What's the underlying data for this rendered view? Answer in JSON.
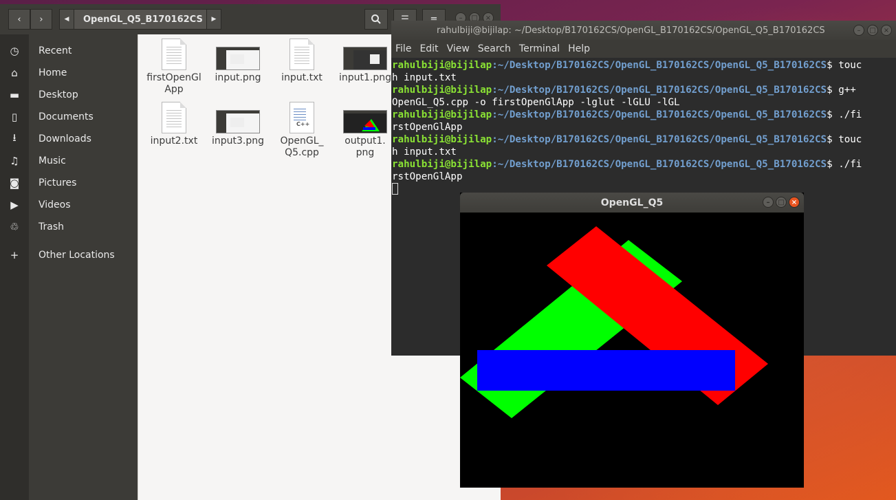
{
  "files": {
    "current_folder": "OpenGL_Q5_B170162CS",
    "places": [
      {
        "icon": "clock-icon",
        "glyph": "◷",
        "label": "Recent"
      },
      {
        "icon": "home-icon",
        "glyph": "⌂",
        "label": "Home"
      },
      {
        "icon": "folder-icon",
        "glyph": "▬",
        "label": "Desktop"
      },
      {
        "icon": "document-icon",
        "glyph": "▯",
        "label": "Documents"
      },
      {
        "icon": "download-icon",
        "glyph": "⭳",
        "label": "Downloads"
      },
      {
        "icon": "music-icon",
        "glyph": "♫",
        "label": "Music"
      },
      {
        "icon": "camera-icon",
        "glyph": "◙",
        "label": "Pictures"
      },
      {
        "icon": "video-icon",
        "glyph": "▶",
        "label": "Videos"
      },
      {
        "icon": "trash-icon",
        "glyph": "♲",
        "label": "Trash"
      },
      {
        "icon": "plus-icon",
        "glyph": "+",
        "label": "Other Locations"
      }
    ],
    "items": [
      {
        "name_line1": "firstOpenGl",
        "name_line2": "App",
        "kind": "doc"
      },
      {
        "name_line1": "input.png",
        "name_line2": "",
        "kind": "image"
      },
      {
        "name_line1": "input.txt",
        "name_line2": "",
        "kind": "doc"
      },
      {
        "name_line1": "input1.png",
        "name_line2": "",
        "kind": "image"
      },
      {
        "name_line1": "input2.txt",
        "name_line2": "",
        "kind": "doc"
      },
      {
        "name_line1": "input3.png",
        "name_line2": "",
        "kind": "image"
      },
      {
        "name_line1": "OpenGL_",
        "name_line2": "Q5.cpp",
        "kind": "cpp"
      },
      {
        "name_line1": "output1.",
        "name_line2": "png",
        "kind": "output"
      }
    ],
    "cpp_tag": "C++"
  },
  "terminal": {
    "title": "rahulbiji@bijilap: ~/Desktop/B170162CS/OpenGL_B170162CS/OpenGL_Q5_B170162CS",
    "menu": [
      "File",
      "Edit",
      "View",
      "Search",
      "Terminal",
      "Help"
    ],
    "user_host": "rahulbiji@bijilap",
    "cwd": ":~/Desktop/B170162CS/OpenGL_B170162CS/OpenGL_Q5_B170162CS",
    "prompt_end": "$ ",
    "lines": [
      {
        "type": "prompt",
        "text": "touc"
      },
      {
        "type": "out",
        "text": "h input.txt"
      },
      {
        "type": "prompt",
        "text": "g++"
      },
      {
        "type": "out",
        "text": "OpenGL_Q5.cpp -o firstOpenGlApp -lglut -lGLU -lGL"
      },
      {
        "type": "prompt",
        "text": "./fi"
      },
      {
        "type": "out",
        "text": "rstOpenGlApp"
      },
      {
        "type": "prompt",
        "text": "touc"
      },
      {
        "type": "out",
        "text": "h input.txt"
      },
      {
        "type": "prompt",
        "text": "./fi"
      },
      {
        "type": "out",
        "text": "rstOpenGlApp"
      }
    ]
  },
  "gl_window": {
    "title": "OpenGL_Q5",
    "background": "#000000",
    "shapes": [
      {
        "name": "green-rectangle",
        "color": "#00ff00"
      },
      {
        "name": "red-rectangle",
        "color": "#ff0000"
      },
      {
        "name": "blue-rectangle",
        "color": "#0000ff"
      }
    ]
  }
}
